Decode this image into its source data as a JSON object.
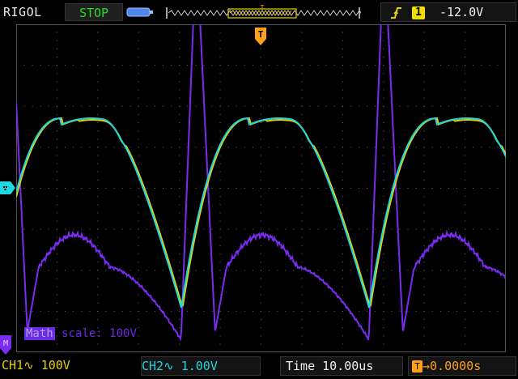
{
  "header": {
    "brand": "RIGOL",
    "run_state": "STOP",
    "trigger": {
      "edge_icon": "rising-edge-icon",
      "source": "1",
      "level": "-12.0V"
    }
  },
  "markers": {
    "trigger_pos": "T",
    "trigger_top": "T",
    "math": "M"
  },
  "math": {
    "tag": "Math",
    "scale_text": "scale: 100V"
  },
  "footer": {
    "ch1": "CH1∿  100V",
    "ch2": "CH2∿  1.00V",
    "time": "Time 10.00us",
    "trigger_pos_icon": "T",
    "trigger_offset": "→0.0000s"
  },
  "colors": {
    "ch1": "#e6d200",
    "ch2": "#20d6e0",
    "math": "#7a2cf0",
    "trigger": "#ff9f1a",
    "grid": "#5a5a5a"
  }
}
